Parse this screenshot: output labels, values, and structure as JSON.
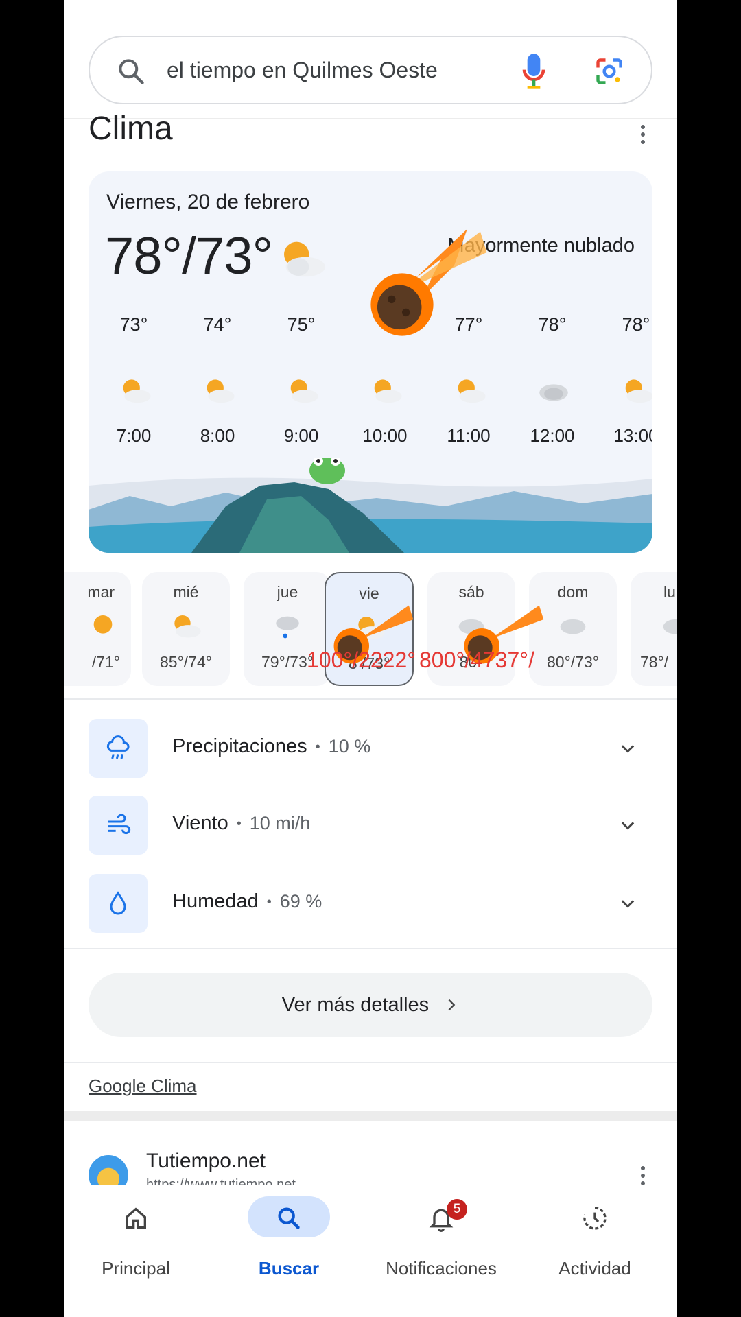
{
  "search": {
    "query": "el tiempo en Quilmes Oeste"
  },
  "weather": {
    "title": "Clima",
    "date": "Viernes, 20 de febrero",
    "temp_range": "78°/73°",
    "condition": "Mayormente nublado",
    "hourly": [
      {
        "temp": "73°",
        "time": "7:00",
        "icon": "partly-cloudy-icon"
      },
      {
        "temp": "74°",
        "time": "8:00",
        "icon": "partly-cloudy-icon"
      },
      {
        "temp": "75°",
        "time": "9:00",
        "icon": "partly-cloudy-icon"
      },
      {
        "temp": "",
        "time": "10:00",
        "icon": "partly-cloudy-icon"
      },
      {
        "temp": "77°",
        "time": "11:00",
        "icon": "partly-cloudy-icon"
      },
      {
        "temp": "78°",
        "time": "12:00",
        "icon": "cloudy-icon"
      },
      {
        "temp": "78°",
        "time": "13:00",
        "icon": "partly-cloudy-icon"
      }
    ],
    "daily": [
      {
        "day": "mar",
        "temps": "/71°",
        "icon": "sunny-icon"
      },
      {
        "day": "mié",
        "temps": "85°/74°",
        "icon": "partly-cloudy-icon"
      },
      {
        "day": "jue",
        "temps": "79°/73°",
        "icon": "rain-icon"
      },
      {
        "day": "vie",
        "temps": "8 /73°",
        "icon": "partly-cloudy-icon"
      },
      {
        "day": "sáb",
        "temps": "80°",
        "icon": "cloudy-icon"
      },
      {
        "day": "dom",
        "temps": "80°/73°",
        "icon": "cloudy-icon"
      },
      {
        "day": "lu",
        "temps": "78°/",
        "icon": "cloudy-icon"
      }
    ],
    "overlay_text_1": "100°/2222°",
    "overlay_text_2": "800°/4737°/"
  },
  "details": [
    {
      "label": "Precipitaciones",
      "value": "10 %",
      "icon": "rain-cloud-icon"
    },
    {
      "label": "Viento",
      "value": "10 mi/h",
      "icon": "wind-icon"
    },
    {
      "label": "Humedad",
      "value": "69 %",
      "icon": "droplet-icon"
    }
  ],
  "more_button": "Ver más detalles",
  "source_link": "Google Clima",
  "result": {
    "name": "Tutiempo.net",
    "url": "https://www.tutiempo.net"
  },
  "nav": {
    "home": "Principal",
    "search": "Buscar",
    "notifications": "Notificaciones",
    "notification_count": "5",
    "activity": "Actividad"
  },
  "colors": {
    "accent": "#0b57d0",
    "nav_pill": "#d3e3fd",
    "detail_bg": "#e8f0fe",
    "overlay_red": "#e53935"
  }
}
